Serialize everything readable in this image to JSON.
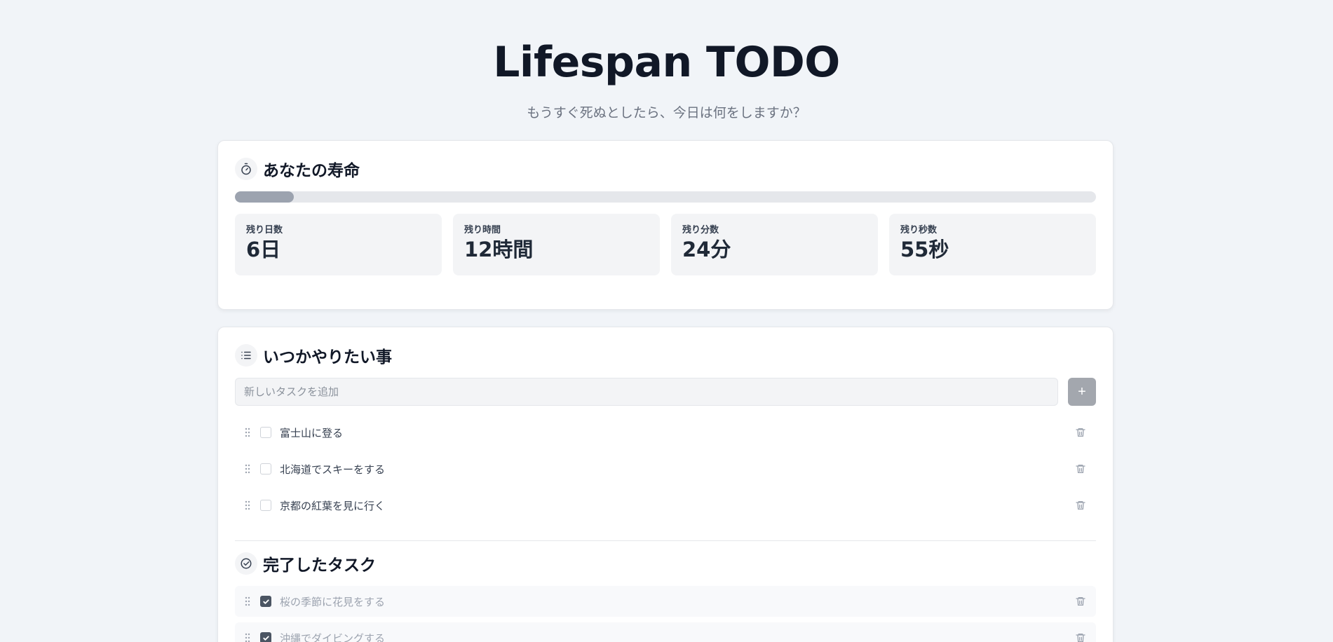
{
  "header": {
    "title": "Lifespan TODO",
    "subtitle": "もうすぐ死ぬとしたら、今日は何をしますか？"
  },
  "lifespan": {
    "title": "あなたの寿命",
    "icon": "stopwatch-icon",
    "progress_fraction": 0.068,
    "stats": [
      {
        "label": "残り日数",
        "value": "6日"
      },
      {
        "label": "残り時間",
        "value": "12時間"
      },
      {
        "label": "残り分数",
        "value": "24分"
      },
      {
        "label": "残り秒数",
        "value": "55秒"
      }
    ]
  },
  "todo": {
    "title": "いつかやりたい事",
    "icon": "list-icon",
    "input_placeholder": "新しいタスクを追加",
    "add_button": "+",
    "tasks": [
      {
        "text": "富士山に登る",
        "done": false
      },
      {
        "text": "北海道でスキーをする",
        "done": false
      },
      {
        "text": "京都の紅葉を見に行く",
        "done": false
      }
    ]
  },
  "completed": {
    "title": "完了したタスク",
    "icon": "check-circle-icon",
    "tasks": [
      {
        "text": "桜の季節に花見をする",
        "done": true
      },
      {
        "text": "沖縄でダイビングする",
        "done": true
      }
    ]
  },
  "colors": {
    "background": "#f1f4f8",
    "card": "#ffffff",
    "progress_fill": "#9ca3af",
    "checked": "#4b5563"
  }
}
